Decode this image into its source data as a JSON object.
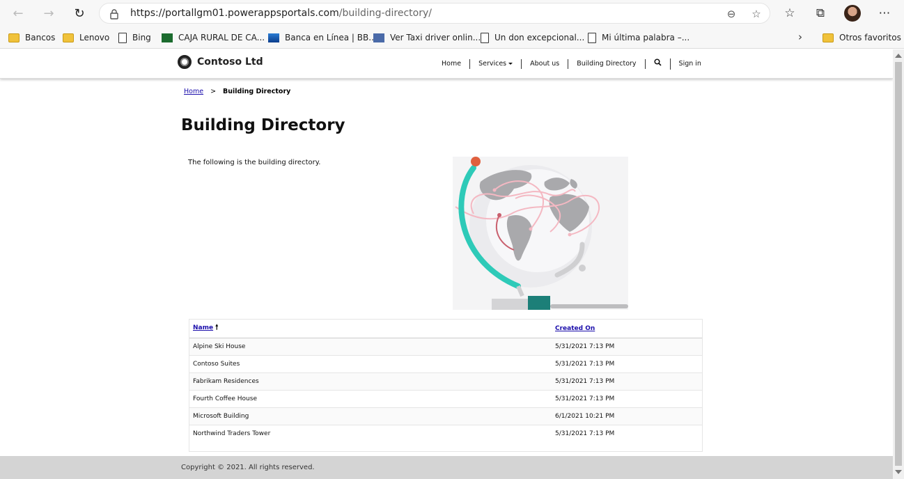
{
  "browser": {
    "url_host": "https://portallgm01.powerappsportals.com",
    "url_path": "/building-directory/",
    "bookmarks": [
      {
        "label": "Bancos",
        "icon": "folder-icon"
      },
      {
        "label": "Lenovo",
        "icon": "folder-icon"
      },
      {
        "label": "Bing",
        "icon": "page-icon"
      },
      {
        "label": "CAJA RURAL DE CA...",
        "icon": "caja-rural-icon"
      },
      {
        "label": "Banca en Línea | BB...",
        "icon": "banca-icon"
      },
      {
        "label": "Ver Taxi driver onlin...",
        "icon": "taxi-icon"
      },
      {
        "label": "Un don excepcional...",
        "icon": "page-icon"
      },
      {
        "label": "Mi última palabra –...",
        "icon": "page-icon"
      }
    ],
    "other_favorites": "Otros favoritos"
  },
  "site": {
    "brand": "Contoso Ltd",
    "nav": {
      "home": "Home",
      "services": "Services",
      "about": "About us",
      "building_directory": "Building Directory",
      "sign_in": "Sign in"
    }
  },
  "breadcrumb": {
    "home": "Home",
    "separator": ">",
    "current": "Building Directory"
  },
  "page": {
    "title": "Building Directory",
    "intro": "The following is the building directory."
  },
  "grid": {
    "columns": {
      "name": "Name",
      "created_on": "Created On"
    },
    "sort_indicator": "🠕",
    "rows": [
      {
        "name": "Alpine Ski House",
        "created_on": "5/31/2021 7:13 PM"
      },
      {
        "name": "Contoso Suites",
        "created_on": "5/31/2021 7:13 PM"
      },
      {
        "name": "Fabrikam Residences",
        "created_on": "5/31/2021 7:13 PM"
      },
      {
        "name": "Fourth Coffee House",
        "created_on": "5/31/2021 7:13 PM"
      },
      {
        "name": "Microsoft Building",
        "created_on": "6/1/2021 10:21 PM"
      },
      {
        "name": "Northwind Traders Tower",
        "created_on": "5/31/2021 7:13 PM"
      }
    ]
  },
  "footer": {
    "copyright": "Copyright © 2021. All rights reserved."
  },
  "colors": {
    "link": "#1a0dab",
    "footer_bg": "#d4d4d4",
    "globe_teal": "#2ecab8",
    "globe_route": "#f4b8c2"
  }
}
